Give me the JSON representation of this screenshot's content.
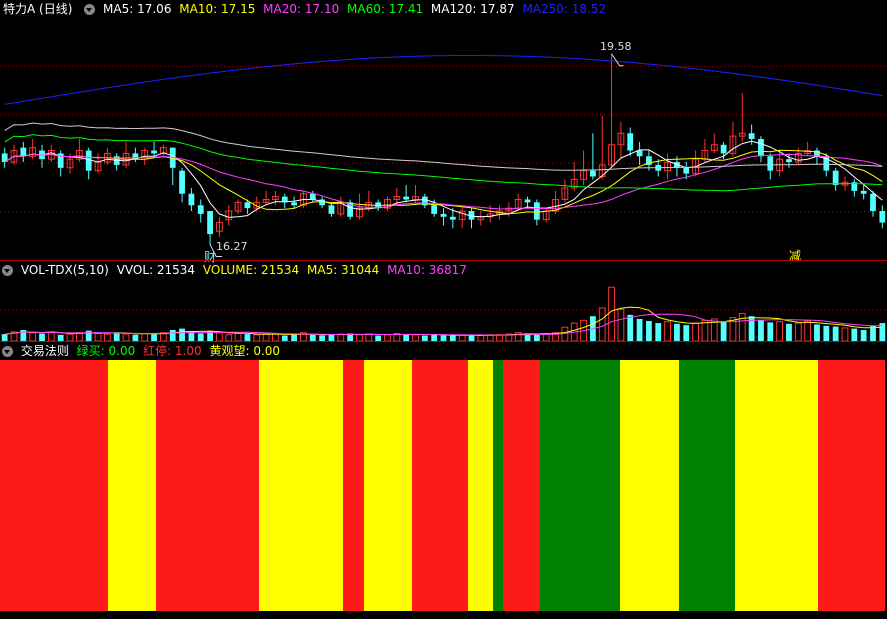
{
  "price_panel": {
    "title": "特力A (日线)",
    "indicators": [
      {
        "label": "MA5: 17.06",
        "color": "#ffffff"
      },
      {
        "label": "MA10: 17.15",
        "color": "#ffff00"
      },
      {
        "label": "MA20: 17.10",
        "color": "#ff40ff"
      },
      {
        "label": "MA60: 17.41",
        "color": "#00ff00"
      },
      {
        "label": "MA120: 17.87",
        "color": "#ffffff"
      },
      {
        "label": "MA250: 18.52",
        "color": "#2020ff"
      }
    ],
    "high_marker": "19.58",
    "low_marker": "16.27",
    "event_cai": "财",
    "event_jian": "减"
  },
  "volume_panel": {
    "title": "VOL-TDX(5,10)",
    "indicators": [
      {
        "label": "VVOL: 21534",
        "color": "#ffffff"
      },
      {
        "label": "VOLUME: 21534",
        "color": "#ffff00"
      },
      {
        "label": "MA5: 31044",
        "color": "#ffff00"
      },
      {
        "label": "MA10: 36817",
        "color": "#ff40ff"
      }
    ]
  },
  "rule_panel": {
    "title": "交易法则",
    "indicators": [
      {
        "label": "绿买: 0.00",
        "color": "#00ff00"
      },
      {
        "label": "红停: 1.00",
        "color": "#ff3030"
      },
      {
        "label": "黄观望: 0.00",
        "color": "#ffff00"
      }
    ]
  },
  "colors": {
    "up": "#ff3333",
    "down": "#54ffff",
    "grid": "#b00000",
    "band_red": "#ff1a1a",
    "band_yellow": "#ffff00",
    "band_green": "#008000"
  },
  "chart_data": {
    "type": "candlestick",
    "y_range": [
      16.0,
      20.2
    ],
    "candles": [
      [
        17.85,
        17.7,
        17.95,
        17.6
      ],
      [
        17.7,
        17.9,
        18.0,
        17.65
      ],
      [
        17.95,
        17.8,
        18.05,
        17.7
      ],
      [
        17.8,
        17.95,
        18.1,
        17.75
      ],
      [
        17.9,
        17.75,
        18.0,
        17.6
      ],
      [
        17.75,
        17.9,
        18.0,
        17.7
      ],
      [
        17.85,
        17.6,
        17.9,
        17.45
      ],
      [
        17.6,
        17.75,
        17.85,
        17.5
      ],
      [
        17.75,
        17.9,
        18.1,
        17.7
      ],
      [
        17.9,
        17.55,
        17.95,
        17.4
      ],
      [
        17.55,
        17.7,
        17.85,
        17.5
      ],
      [
        17.7,
        17.85,
        17.95,
        17.65
      ],
      [
        17.8,
        17.65,
        17.85,
        17.55
      ],
      [
        17.65,
        17.85,
        18.05,
        17.6
      ],
      [
        17.85,
        17.75,
        17.95,
        17.7
      ],
      [
        17.75,
        17.9,
        17.95,
        17.65
      ],
      [
        17.9,
        17.85,
        18.05,
        17.8
      ],
      [
        17.85,
        17.95,
        18.0,
        17.8
      ],
      [
        17.95,
        17.6,
        17.95,
        17.3
      ],
      [
        17.55,
        17.15,
        17.6,
        17.0
      ],
      [
        17.15,
        16.95,
        17.25,
        16.85
      ],
      [
        16.95,
        16.8,
        17.05,
        16.65
      ],
      [
        16.85,
        16.45,
        16.85,
        16.27
      ],
      [
        16.5,
        16.65,
        16.75,
        16.4
      ],
      [
        16.7,
        16.85,
        16.95,
        16.6
      ],
      [
        16.85,
        17.0,
        17.05,
        16.8
      ],
      [
        17.0,
        16.9,
        17.05,
        16.8
      ],
      [
        16.9,
        17.0,
        17.1,
        16.85
      ],
      [
        17.0,
        17.05,
        17.2,
        16.95
      ],
      [
        17.05,
        17.1,
        17.2,
        16.95
      ],
      [
        17.1,
        17.0,
        17.15,
        16.9
      ],
      [
        17.0,
        16.95,
        17.1,
        16.9
      ],
      [
        16.95,
        17.15,
        17.2,
        16.9
      ],
      [
        17.15,
        17.05,
        17.2,
        17.0
      ],
      [
        17.05,
        16.95,
        17.1,
        16.9
      ],
      [
        16.95,
        16.8,
        17.0,
        16.75
      ],
      [
        16.8,
        17.0,
        17.1,
        16.75
      ],
      [
        17.0,
        16.75,
        17.05,
        16.7
      ],
      [
        16.75,
        16.9,
        17.15,
        16.7
      ],
      [
        16.9,
        17.0,
        17.2,
        16.85
      ],
      [
        17.0,
        16.9,
        17.05,
        16.85
      ],
      [
        16.9,
        17.05,
        17.1,
        16.85
      ],
      [
        17.05,
        17.1,
        17.25,
        16.95
      ],
      [
        17.1,
        17.05,
        17.3,
        17.0
      ],
      [
        17.05,
        17.1,
        17.3,
        17.0
      ],
      [
        17.1,
        16.95,
        17.15,
        16.9
      ],
      [
        16.95,
        16.8,
        17.05,
        16.75
      ],
      [
        16.8,
        16.75,
        16.9,
        16.6
      ],
      [
        16.75,
        16.7,
        16.9,
        16.55
      ],
      [
        16.7,
        16.85,
        16.95,
        16.55
      ],
      [
        16.85,
        16.7,
        16.9,
        16.55
      ],
      [
        16.7,
        16.75,
        16.85,
        16.6
      ],
      [
        16.75,
        16.8,
        16.95,
        16.65
      ],
      [
        16.8,
        16.85,
        16.95,
        16.7
      ],
      [
        16.85,
        16.9,
        17.0,
        16.75
      ],
      [
        16.9,
        17.05,
        17.15,
        16.85
      ],
      [
        17.05,
        17.0,
        17.1,
        16.9
      ],
      [
        17.0,
        16.7,
        17.05,
        16.6
      ],
      [
        16.7,
        16.85,
        16.9,
        16.65
      ],
      [
        16.85,
        17.05,
        17.2,
        16.8
      ],
      [
        17.05,
        17.25,
        17.4,
        17.0
      ],
      [
        17.25,
        17.4,
        17.7,
        17.2
      ],
      [
        17.4,
        17.55,
        17.9,
        17.3
      ],
      [
        17.55,
        17.45,
        18.2,
        17.4
      ],
      [
        17.45,
        17.65,
        18.5,
        17.4
      ],
      [
        17.65,
        18.0,
        19.58,
        17.6
      ],
      [
        18.0,
        18.2,
        18.4,
        17.75
      ],
      [
        18.2,
        17.9,
        18.3,
        17.8
      ],
      [
        17.9,
        17.8,
        18.05,
        17.65
      ],
      [
        17.8,
        17.65,
        17.9,
        17.55
      ],
      [
        17.65,
        17.55,
        17.75,
        17.45
      ],
      [
        17.55,
        17.7,
        17.85,
        17.4
      ],
      [
        17.7,
        17.6,
        17.8,
        17.45
      ],
      [
        17.6,
        17.5,
        17.7,
        17.4
      ],
      [
        17.5,
        17.75,
        17.9,
        17.45
      ],
      [
        17.75,
        17.9,
        18.1,
        17.7
      ],
      [
        17.9,
        18.0,
        18.2,
        17.85
      ],
      [
        18.0,
        17.85,
        18.05,
        17.75
      ],
      [
        17.85,
        18.15,
        18.4,
        17.8
      ],
      [
        18.15,
        18.2,
        18.9,
        18.05
      ],
      [
        18.2,
        18.1,
        18.35,
        18.0
      ],
      [
        18.1,
        17.8,
        18.15,
        17.7
      ],
      [
        17.8,
        17.55,
        17.85,
        17.4
      ],
      [
        17.55,
        17.75,
        17.9,
        17.45
      ],
      [
        17.75,
        17.7,
        17.85,
        17.6
      ],
      [
        17.7,
        17.85,
        17.95,
        17.65
      ],
      [
        17.85,
        17.9,
        18.05,
        17.8
      ],
      [
        17.9,
        17.8,
        17.95,
        17.65
      ],
      [
        17.8,
        17.55,
        17.85,
        17.45
      ],
      [
        17.55,
        17.3,
        17.6,
        17.2
      ],
      [
        17.3,
        17.35,
        17.45,
        17.2
      ],
      [
        17.35,
        17.2,
        17.4,
        17.1
      ],
      [
        17.2,
        17.15,
        17.3,
        17.05
      ],
      [
        17.15,
        16.85,
        17.2,
        16.75
      ],
      [
        16.85,
        16.65,
        16.95,
        16.55
      ]
    ],
    "volume_range": [
      0,
      9
    ],
    "volume": [
      1.0,
      1.3,
      1.6,
      1.2,
      1.1,
      1.3,
      0.9,
      1.0,
      1.2,
      1.5,
      1.1,
      1.0,
      1.2,
      1.0,
      0.9,
      1.1,
      1.0,
      1.2,
      1.6,
      1.8,
      1.3,
      1.1,
      1.4,
      1.2,
      0.9,
      1.1,
      1.0,
      0.9,
      1.0,
      1.1,
      0.8,
      0.9,
      1.2,
      0.9,
      0.8,
      0.9,
      1.0,
      1.1,
      0.9,
      1.0,
      0.8,
      0.9,
      1.1,
      1.0,
      0.9,
      0.8,
      0.9,
      0.8,
      0.8,
      0.9,
      0.8,
      0.8,
      0.9,
      0.9,
      1.0,
      1.2,
      1.1,
      0.9,
      1.0,
      1.2,
      2.0,
      2.6,
      3.0,
      3.6,
      4.8,
      7.8,
      4.6,
      3.8,
      3.2,
      2.9,
      2.6,
      2.8,
      2.5,
      2.3,
      2.6,
      3.0,
      3.2,
      2.8,
      3.4,
      4.0,
      3.6,
      3.0,
      2.7,
      2.8,
      2.5,
      2.6,
      2.9,
      2.4,
      2.2,
      2.1,
      1.9,
      1.8,
      1.6,
      2.2,
      2.6
    ]
  },
  "rule_bands": [
    {
      "w": 108,
      "c": "red"
    },
    {
      "w": 48,
      "c": "yellow"
    },
    {
      "w": 103,
      "c": "red"
    },
    {
      "w": 84,
      "c": "yellow"
    },
    {
      "w": 21,
      "c": "red"
    },
    {
      "w": 48,
      "c": "yellow"
    },
    {
      "w": 56,
      "c": "red"
    },
    {
      "w": 25,
      "c": "yellow"
    },
    {
      "w": 10,
      "c": "green"
    },
    {
      "w": 37,
      "c": "red"
    },
    {
      "w": 80,
      "c": "green"
    },
    {
      "w": 59,
      "c": "yellow"
    },
    {
      "w": 56,
      "c": "green"
    },
    {
      "w": 83,
      "c": "yellow"
    },
    {
      "w": 67,
      "c": "red"
    }
  ]
}
